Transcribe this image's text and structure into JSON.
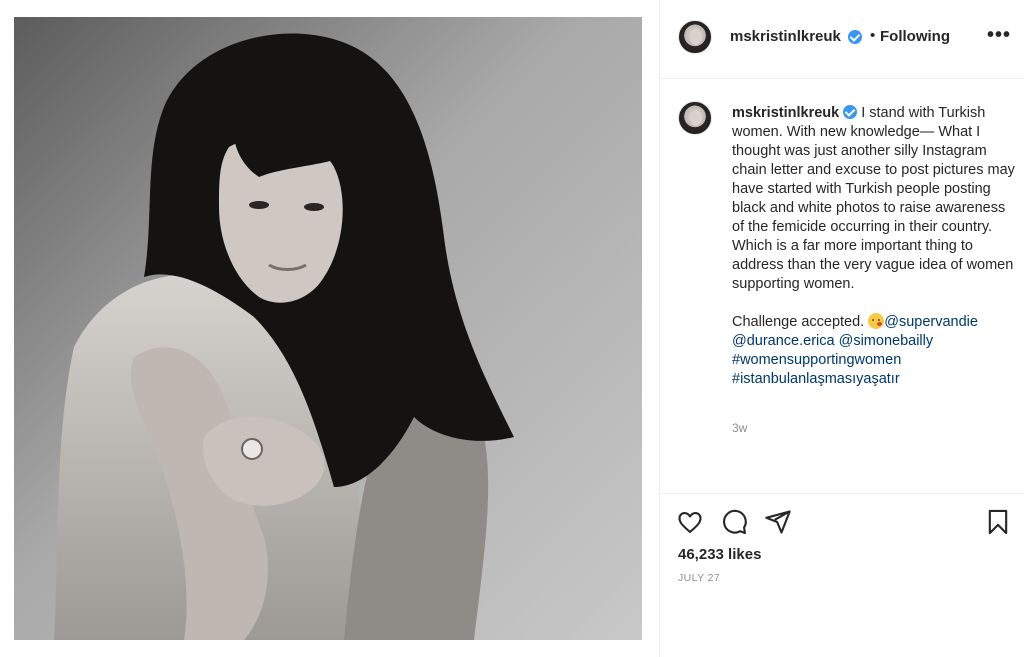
{
  "post": {
    "username": "mskristinlkreuk",
    "verified": true,
    "follow_separator": "•",
    "follow_status": "Following",
    "more_label": "•••",
    "photo_alt": "",
    "caption": {
      "text_1": "I stand with Turkish women. With new knowledge— What I thought was just another silly Instagram chain letter and excuse to post pictures may have started with Turkish people posting black and white photos to raise awareness of the femicide occurring in their country. Which is a far more important thing to address than the very vague idea of women supporting women.",
      "text_2": "Challenge accepted. ",
      "emoji_icon": "kissing-face-icon",
      "mentions": [
        "@supervandie",
        "@durance.erica",
        "@simonebailly"
      ],
      "hashtags": [
        "#womensupportingwomen",
        "#istanbulanlaşmasıyaşatır"
      ]
    },
    "time_ago": "3w",
    "likes": "46,233 likes",
    "date": "JULY 27",
    "icons": {
      "like": "heart-icon",
      "comment": "comment-icon",
      "share": "paper-plane-icon",
      "save": "bookmark-icon",
      "verified": "verified-badge-icon"
    },
    "colors": {
      "verified": "#3897f0",
      "link": "#00376b",
      "secondary_text": "#8e8e8e"
    }
  }
}
